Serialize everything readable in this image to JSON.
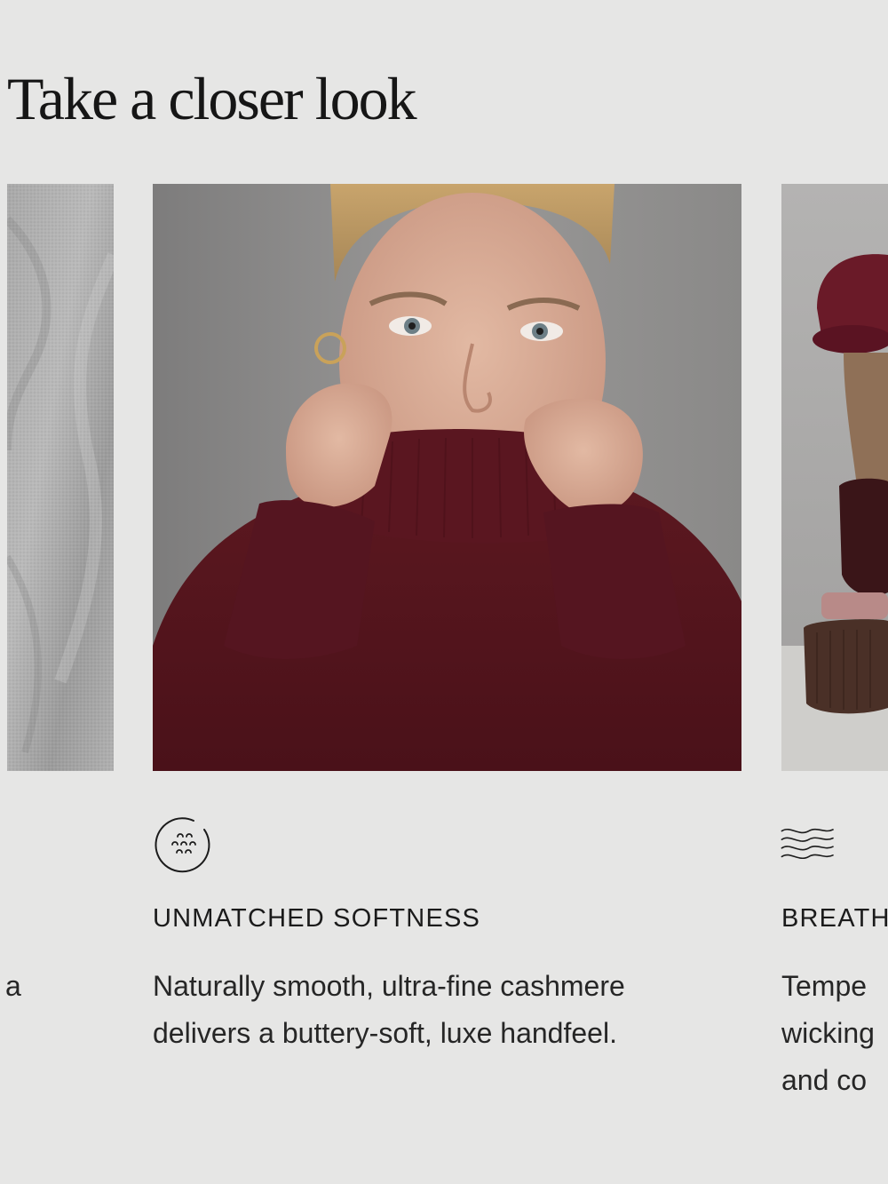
{
  "section": {
    "heading": "Take a closer look"
  },
  "cards": {
    "left": {
      "text_fragment": "a"
    },
    "center": {
      "icon": "softness-dots-circle-icon",
      "title": "UNMATCHED SOFTNESS",
      "text_line1": "Naturally smooth, ultra-fine cashmere",
      "text_line2": "delivers a buttery-soft, luxe handfeel."
    },
    "right": {
      "icon": "breathable-waves-icon",
      "title": "BREATH",
      "text_line1": "Tempe",
      "text_line2": "wicking",
      "text_line3": "and co"
    }
  },
  "colors": {
    "background": "#e6e6e5",
    "text": "#1b1b1b",
    "sweater_burgundy": "#5e1a22",
    "heather_gray": "#a8a8a8"
  }
}
